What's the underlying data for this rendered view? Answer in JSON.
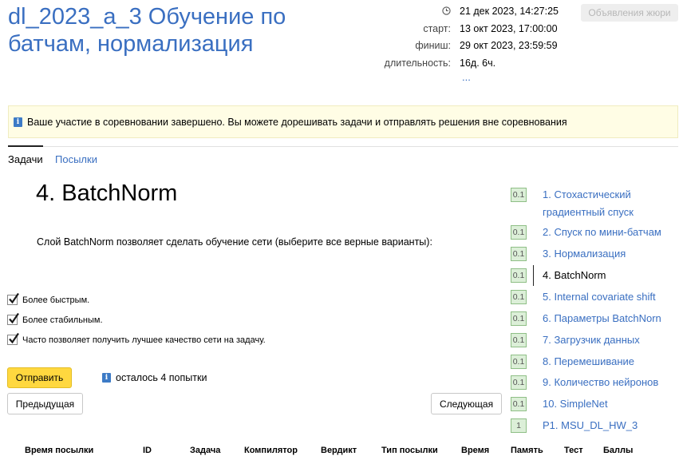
{
  "contest": {
    "title": "dl_2023_a_3 Обучение по батчам, нормализация",
    "current_time": "21 дек 2023, 14:27:25",
    "start_label": "старт:",
    "start": "13 окт 2023, 17:00:00",
    "finish_label": "финиш:",
    "finish": "29 окт 2023, 23:59:59",
    "duration_label": "длительность:",
    "duration": "16д. 6ч.",
    "more": "...",
    "jury_button": "Объявления жюри"
  },
  "notice": "Ваше участие в соревновании завершено. Вы можете дорешивать задачи и отправлять решения вне соревнования",
  "tabs": [
    {
      "label": "Задачи",
      "active": true
    },
    {
      "label": "Посылки",
      "active": false
    }
  ],
  "problem": {
    "title": "4. BatchNorm",
    "statement": "Слой BatchNorm позволяет сделать обучение сети (выберите все верные варианты):",
    "options": [
      {
        "label": "Более быстрым.",
        "checked": true
      },
      {
        "label": "Более стабильным.",
        "checked": true
      },
      {
        "label": "Часто позволяет получить лучшее качество сети на задачу.",
        "checked": true
      }
    ],
    "submit": "Отправить",
    "attempts": "осталось 4 попытки",
    "prev": "Предыдущая",
    "next": "Следующая"
  },
  "submissions_table": {
    "headers": [
      "Время посылки",
      "ID",
      "Задача",
      "Компилятор",
      "Вердикт",
      "Тип посылки",
      "Время",
      "Память",
      "Тест",
      "Баллы"
    ]
  },
  "problems_list": [
    {
      "score": "0.1",
      "label": "1. Стохастический градиентный спуск",
      "active": false
    },
    {
      "score": "0.1",
      "label": "2. Спуск по мини-батчам",
      "active": false
    },
    {
      "score": "0.1",
      "label": "3. Нормализация",
      "active": false
    },
    {
      "score": "0.1",
      "label": "4. BatchNorm",
      "active": true
    },
    {
      "score": "0.1",
      "label": "5. Internal covariate shift",
      "active": false
    },
    {
      "score": "0.1",
      "label": "6. Параметры BatchNorn",
      "active": false
    },
    {
      "score": "0.1",
      "label": "7. Загрузчик данных",
      "active": false
    },
    {
      "score": "0.1",
      "label": "8. Перемешивание",
      "active": false
    },
    {
      "score": "0.1",
      "label": "9. Количество нейронов",
      "active": false
    },
    {
      "score": "0.1",
      "label": "10. SimpleNet",
      "active": false
    },
    {
      "score": "1",
      "label": "P1. MSU_DL_HW_3",
      "active": false
    }
  ],
  "colors": {
    "link": "#3a6fc1",
    "submit": "#ffd83f",
    "notice_bg": "#fffde5",
    "badge_bg": "#dcefd8"
  }
}
